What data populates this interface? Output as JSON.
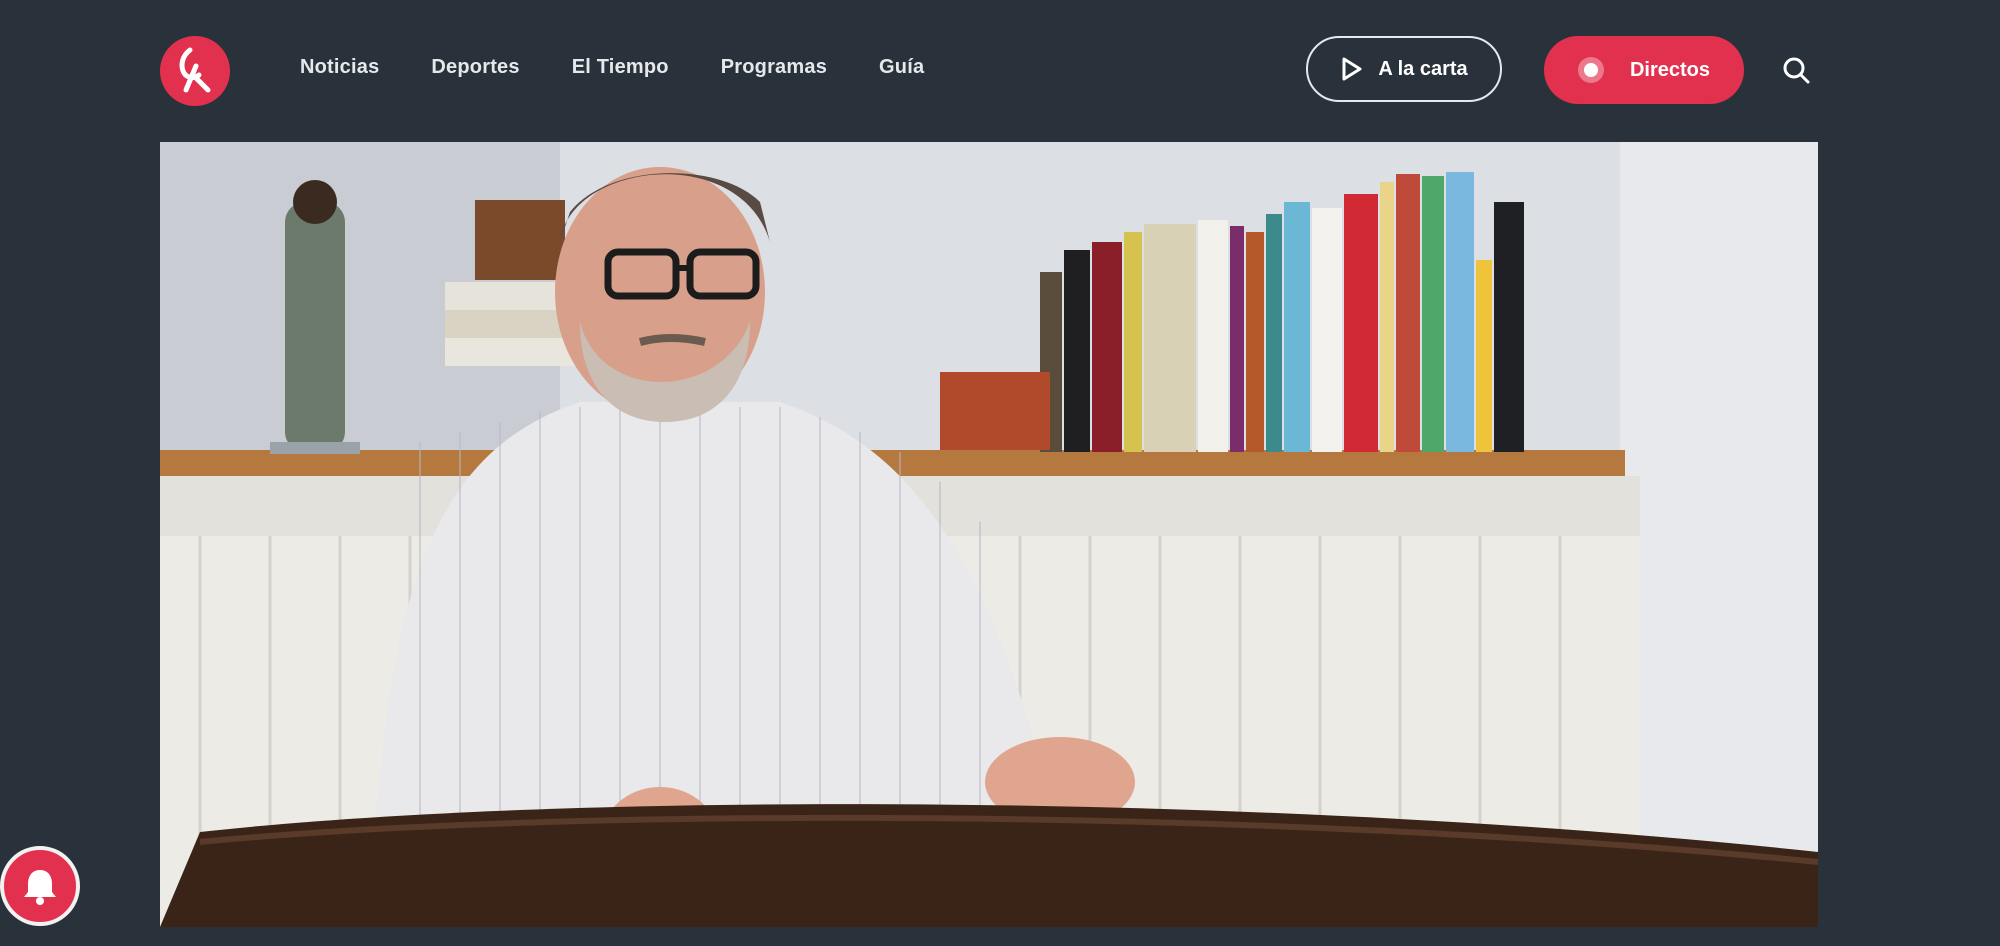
{
  "header": {
    "logo_icon": "rtvc-logo-icon",
    "nav": [
      {
        "label": "Noticias"
      },
      {
        "label": "Deportes"
      },
      {
        "label": "El Tiempo"
      },
      {
        "label": "Programas"
      },
      {
        "label": "Guía"
      }
    ],
    "a_la_carta_label": "A la carta",
    "a_la_carta_icon": "play-icon",
    "directos_label": "Directos",
    "directos_icon": "live-dot-icon",
    "search_icon": "search-icon"
  },
  "video": {
    "description_icon": "video-player"
  },
  "notifications": {
    "icon": "bell-icon"
  },
  "colors": {
    "background": "#29323a",
    "accent": "#e2314f",
    "text": "#e6e9ec"
  }
}
